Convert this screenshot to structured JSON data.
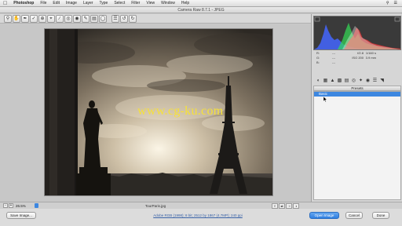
{
  "menubar": {
    "apple_icon": "apple-icon",
    "app_name": "Photoshop",
    "items": [
      "File",
      "Edit",
      "Image",
      "Layer",
      "Type",
      "Select",
      "Filter",
      "View",
      "Window",
      "Help"
    ]
  },
  "window": {
    "title": "Camera Raw 8.7.1 - JPEG"
  },
  "toolbar": {
    "tools": [
      "zoom-tool",
      "hand-tool",
      "white-balance-tool",
      "color-sampler-tool",
      "targeted-adjustment-tool",
      "crop-tool",
      "straighten-tool",
      "spot-removal-tool",
      "red-eye-removal-tool",
      "adjustment-brush-tool",
      "graduated-filter-tool",
      "radial-filter-tool",
      "preferences-tool",
      "rotate-ccw-tool",
      "rotate-cw-tool"
    ]
  },
  "preview": {
    "watermark": "www.cg-ku.com"
  },
  "histogram": {
    "readout": {
      "r_label": "R:",
      "r_value": "---",
      "g_label": "G:",
      "g_value": "---",
      "b_label": "B:",
      "b_value": "---",
      "exposure": "f/2.8",
      "shutter": "1/160 s",
      "iso": "ISO 200",
      "focal": "3.9 mm"
    }
  },
  "panel": {
    "tabs": [
      "basic",
      "tone-curve",
      "detail",
      "hsl",
      "split-toning",
      "lens-corrections",
      "effects",
      "camera-calibration",
      "presets",
      "snapshots"
    ],
    "section_title": "Presets",
    "selected_preset": "Basic"
  },
  "statusbar": {
    "zoom_minus": "-",
    "zoom_plus": "+",
    "zoom": "26.5%",
    "filename": "TourParis.jpg"
  },
  "bottom": {
    "save_label": "Save Image...",
    "workflow_text": "Adobe RGB (1998); 8 bit; 2512 by 1867 (4.7MP); 240 ppi",
    "open_label": "Open Image",
    "cancel_label": "Cancel",
    "done_label": "Done"
  },
  "colors": {
    "accent": "#3d87e0",
    "watermark": "#f6e13a"
  }
}
